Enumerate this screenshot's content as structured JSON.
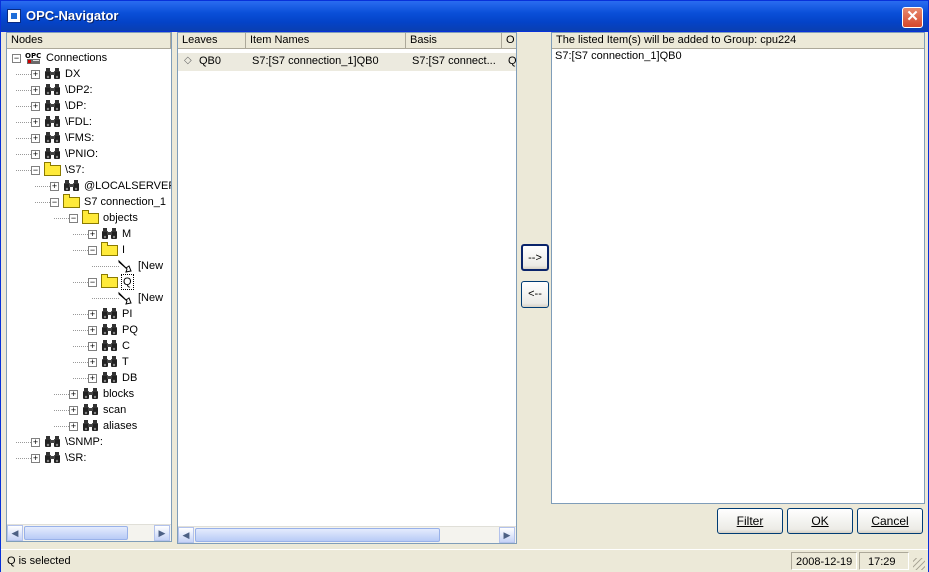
{
  "window": {
    "title": "OPC-Navigator"
  },
  "nodes_panel": {
    "header": "Nodes"
  },
  "tree": [
    {
      "label": "Connections",
      "icon": "opc-server-icon",
      "level": 0,
      "expander": "minus"
    },
    {
      "label": "DX",
      "icon": "binoculars-icon",
      "level": 1,
      "expander": "plus"
    },
    {
      "label": "\\DP2:",
      "icon": "binoculars-icon",
      "level": 1,
      "expander": "plus"
    },
    {
      "label": "\\DP:",
      "icon": "binoculars-icon",
      "level": 1,
      "expander": "plus"
    },
    {
      "label": "\\FDL:",
      "icon": "binoculars-icon",
      "level": 1,
      "expander": "plus"
    },
    {
      "label": "\\FMS:",
      "icon": "binoculars-icon",
      "level": 1,
      "expander": "plus"
    },
    {
      "label": "\\PNIO:",
      "icon": "binoculars-icon",
      "level": 1,
      "expander": "plus"
    },
    {
      "label": "\\S7:",
      "icon": "folder-open-icon",
      "level": 1,
      "expander": "minus"
    },
    {
      "label": "@LOCALSERVER",
      "icon": "binoculars-icon",
      "level": 2,
      "expander": "plus"
    },
    {
      "label": "S7 connection_1",
      "icon": "folder-open-icon",
      "level": 2,
      "expander": "minus"
    },
    {
      "label": "objects",
      "icon": "folder-open-icon",
      "level": 3,
      "expander": "minus"
    },
    {
      "label": "M",
      "icon": "binoculars-icon",
      "level": 4,
      "expander": "plus"
    },
    {
      "label": "I",
      "icon": "folder-open-icon",
      "level": 4,
      "expander": "minus"
    },
    {
      "label": "[New",
      "icon": "new-item-icon",
      "level": 5,
      "expander": "none"
    },
    {
      "label": "Q",
      "icon": "folder-open-icon",
      "level": 4,
      "expander": "minus",
      "selected": true
    },
    {
      "label": "[New",
      "icon": "new-item-icon",
      "level": 5,
      "expander": "none"
    },
    {
      "label": "PI",
      "icon": "binoculars-icon",
      "level": 4,
      "expander": "plus"
    },
    {
      "label": "PQ",
      "icon": "binoculars-icon",
      "level": 4,
      "expander": "plus"
    },
    {
      "label": "C",
      "icon": "binoculars-icon",
      "level": 4,
      "expander": "plus"
    },
    {
      "label": "T",
      "icon": "binoculars-icon",
      "level": 4,
      "expander": "plus"
    },
    {
      "label": "DB",
      "icon": "binoculars-icon",
      "level": 4,
      "expander": "plus"
    },
    {
      "label": "blocks",
      "icon": "binoculars-icon",
      "level": 3,
      "expander": "plus"
    },
    {
      "label": "scan",
      "icon": "binoculars-icon",
      "level": 3,
      "expander": "plus"
    },
    {
      "label": "aliases",
      "icon": "binoculars-icon",
      "level": 3,
      "expander": "plus"
    },
    {
      "label": "\\SNMP:",
      "icon": "binoculars-icon",
      "level": 1,
      "expander": "plus"
    },
    {
      "label": "\\SR:",
      "icon": "binoculars-icon",
      "level": 1,
      "expander": "plus"
    }
  ],
  "leaves_panel": {
    "columns": [
      "Leaves",
      "Item Names",
      "Basis",
      "O"
    ],
    "rows": [
      {
        "leaf": "QB0",
        "item_name": "S7:[S7 connection_1]QB0",
        "basis": "S7:[S7 connect...",
        "other": "Q"
      }
    ]
  },
  "move_buttons": {
    "add": "-->",
    "remove": "<--"
  },
  "selected_panel": {
    "header": "The listed Item(s) will be added to Group: cpu224",
    "items": [
      "S7:[S7 connection_1]QB0"
    ]
  },
  "buttons": {
    "filter": "Filter",
    "ok": "OK",
    "cancel": "Cancel"
  },
  "status": {
    "message": "Q is selected",
    "date": "2008-12-19",
    "time": "17:29"
  }
}
